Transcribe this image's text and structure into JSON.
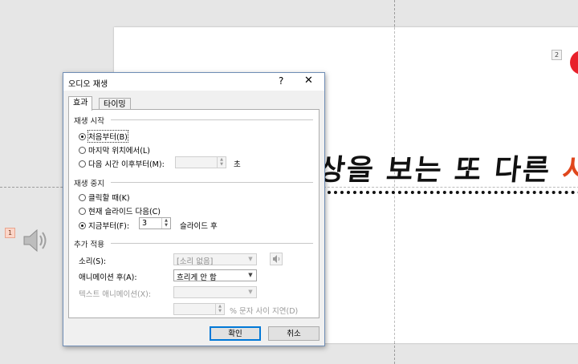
{
  "slide": {
    "headline_main": "상을 보는 또 다른 ",
    "headline_accent": "시",
    "anim_tag_top": "2",
    "anim_tag_left": "1",
    "colors": {
      "accent": "#e0461c",
      "red_dot": "#e8202a"
    }
  },
  "dialog": {
    "title": "오디오 재생",
    "help": "?",
    "close": "✕",
    "tabs": [
      {
        "label": "효과"
      },
      {
        "label": "타이밍"
      }
    ],
    "start": {
      "group": "재생 시작",
      "from_beginning": "처음부터(B)",
      "from_last_position": "마지막 위치에서(L)",
      "from_time": "다음 시간 이후부터(M):",
      "time_unit": "초",
      "time_value": ""
    },
    "stop": {
      "group": "재생 중지",
      "on_click": "클릭할 때(K)",
      "after_current_slide": "현재 슬라이드 다음(C)",
      "after_slides": "지금부터(F):",
      "slides_value": "3",
      "slides_unit": "슬라이드 후"
    },
    "enhancements": {
      "group": "추가 적용",
      "sound_label": "소리(S):",
      "sound_value": "[소리 없음]",
      "after_anim_label": "애니메이션 후(A):",
      "after_anim_value": "흐리게 안 함",
      "text_anim_label": "텍스트 애니메이션(X):",
      "text_anim_value": "",
      "delay_value": "",
      "delay_suffix": "% 문자 사이 지연(D)"
    },
    "buttons": {
      "ok": "확인",
      "cancel": "취소"
    }
  }
}
